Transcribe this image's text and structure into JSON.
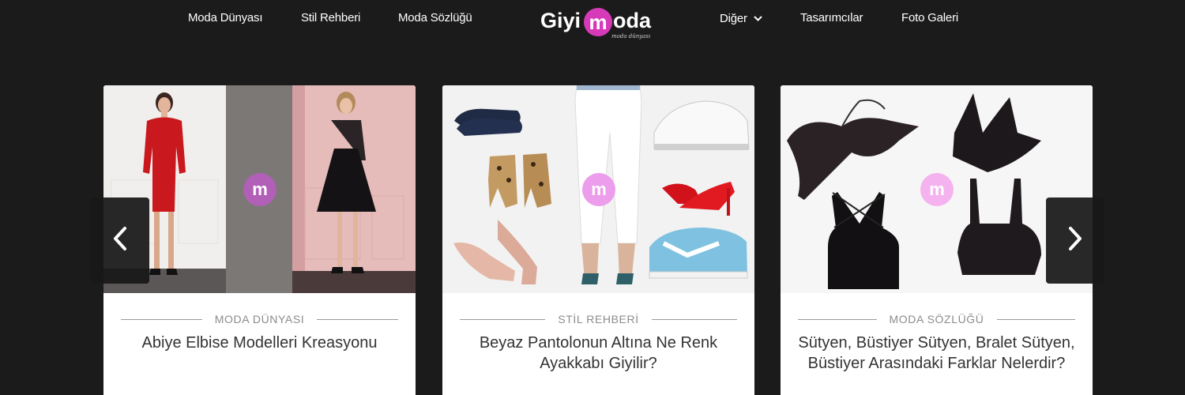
{
  "nav": {
    "left_links": [
      "Moda Dünyası",
      "Stil Rehberi",
      "Moda Sözlüğü"
    ],
    "right_links": [
      {
        "label": "Diğer",
        "has_dropdown": true
      },
      {
        "label": "Tasarımcılar"
      },
      {
        "label": "Foto Galeri"
      }
    ],
    "logo": {
      "text_left": "Giyi",
      "text_badge": "m",
      "text_right": "oda",
      "tagline": "moda dünyası"
    },
    "dropdown_icon": "chevron-down-icon"
  },
  "carousel": {
    "prev_icon": "chevron-left-icon",
    "next_icon": "chevron-right-icon",
    "cards": [
      {
        "category": "MODA DÜNYASI",
        "title": "Abiye Elbise Modelleri Kreasyonu",
        "badge": "m",
        "image": "two women in evening dresses"
      },
      {
        "category": "STİL REHBERİ",
        "title": "Beyaz Pantolonun Altına Ne Renk Ayakkabı Giyilir?",
        "badge": "m",
        "image": "white trousers with assorted shoes"
      },
      {
        "category": "MODA SÖZLÜĞÜ",
        "title": "Sütyen, Büstiyer Sütyen, Bralet Sütyen, Büstiyer Arasındaki Farklar Nelerdir?",
        "badge": "m",
        "image": "black lingerie items"
      }
    ]
  },
  "colors": {
    "background": "#1c1b1c",
    "brand_pink": "#d63ab9",
    "card_bg": "#ffffff",
    "category_text": "#8c8c8c",
    "title_text": "#333333"
  }
}
